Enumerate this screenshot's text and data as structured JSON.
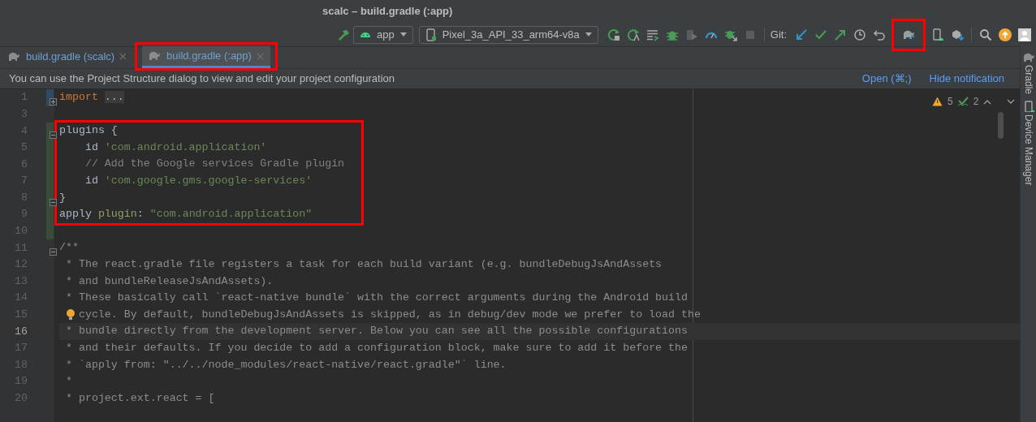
{
  "window": {
    "title": "scalc – build.gradle (:app)"
  },
  "toolbar": {
    "run_config": "app",
    "device": "Pixel_3a_API_33_arm64-v8a",
    "git_label": "Git:",
    "sync_highlighted": true
  },
  "tabs": [
    {
      "label": "build.gradle (scalc)",
      "selected": false,
      "highlighted": false
    },
    {
      "label": "build.gradle (:app)",
      "selected": true,
      "highlighted": true
    }
  ],
  "notification": {
    "text": "You can use the Project Structure dialog to view and edit your project configuration",
    "actions": [
      "Open (⌘;)",
      "Hide notification"
    ]
  },
  "inspections": {
    "warnings": "5",
    "typos": "2"
  },
  "side_tools": [
    "Gradle",
    "Device Manager"
  ],
  "code_blocks": [
    {
      "highlighted": false,
      "lines": [
        {
          "number": "1",
          "has_fold": true,
          "folded": true,
          "color": "#2f4b63",
          "current": false,
          "segments": [
            {
              "kind": "keyword",
              "text": "import"
            },
            {
              "kind": "folded",
              "text": "..."
            }
          ]
        },
        {
          "number": "3",
          "current": false
        }
      ]
    },
    {
      "highlighted": true,
      "lines": [
        {
          "number": "4",
          "has_fold": true,
          "folded": false,
          "color": "#384c38",
          "current": false,
          "segments": [
            {
              "kind": "plain",
              "text": "plugins {"
            }
          ]
        },
        {
          "number": "5",
          "color": "#384c38",
          "current": false,
          "segments": [
            {
              "kind": "plain",
              "text": "    id "
            },
            {
              "kind": "string",
              "text": "'com.android.application'"
            }
          ]
        },
        {
          "number": "6",
          "color": "#384c38",
          "current": false,
          "segments": [
            {
              "kind": "comment",
              "text": "    // Add the Google services Gradle plugin"
            }
          ]
        },
        {
          "number": "7",
          "color": "#384c38",
          "current": false,
          "segments": [
            {
              "kind": "plain",
              "text": "    id "
            },
            {
              "kind": "string",
              "text": "'com.google.gms.google-services'"
            }
          ]
        },
        {
          "number": "8",
          "has_fold": true,
          "folded": false,
          "color": "#384c38",
          "current": false,
          "segments": [
            {
              "kind": "plain",
              "text": "}"
            }
          ]
        },
        {
          "number": "9",
          "color": "#384c38",
          "current": false,
          "segments": [
            {
              "kind": "plain",
              "text": "apply "
            },
            {
              "kind": "param",
              "text": "plugin"
            },
            {
              "kind": "plain",
              "text": ": "
            },
            {
              "kind": "string",
              "text": "\"com.android.application\""
            }
          ]
        }
      ]
    },
    {
      "highlighted": false,
      "lines": [
        {
          "number": "10",
          "color": "#384c38",
          "current": false
        },
        {
          "number": "11",
          "has_fold": true,
          "folded": false,
          "current": false,
          "segments": [
            {
              "kind": "doc",
              "text": "/**"
            }
          ]
        },
        {
          "number": "12",
          "current": false,
          "segments": [
            {
              "kind": "doc",
              "text": " * The react.gradle file registers a task for each build variant (e.g. bundleDebugJsAndAssets"
            }
          ]
        },
        {
          "number": "13",
          "current": false,
          "segments": [
            {
              "kind": "doc",
              "text": " * and bundleReleaseJsAndAssets)."
            }
          ]
        },
        {
          "number": "14",
          "current": false,
          "segments": [
            {
              "kind": "doc",
              "text": " * These basically call `react-native bundle` with the correct arguments during the Android build"
            }
          ]
        },
        {
          "number": "15",
          "bulb": true,
          "current": false,
          "segments": [
            {
              "kind": "doc",
              "text": "cycle. By default, bundleDebugJsAndAssets is skipped, as in debug/dev mode we prefer to load the"
            }
          ]
        },
        {
          "number": "16",
          "current": true,
          "segments": [
            {
              "kind": "doc",
              "text": " * bundle directly from the development server. Below you can see all the possible configurations"
            }
          ]
        },
        {
          "number": "17",
          "current": false,
          "segments": [
            {
              "kind": "doc",
              "text": " * and their defaults. If you decide to add a configuration block, make sure to add it before the"
            }
          ]
        },
        {
          "number": "18",
          "current": false,
          "segments": [
            {
              "kind": "doc",
              "text": " * `apply from: \"../../node_modules/react-native/react.gradle\"` line."
            }
          ]
        },
        {
          "number": "19",
          "current": false,
          "segments": [
            {
              "kind": "doc",
              "text": " *"
            }
          ]
        },
        {
          "number": "20",
          "current": false,
          "segments": [
            {
              "kind": "doc",
              "text": " * project.ext.react = ["
            }
          ]
        }
      ]
    }
  ]
}
